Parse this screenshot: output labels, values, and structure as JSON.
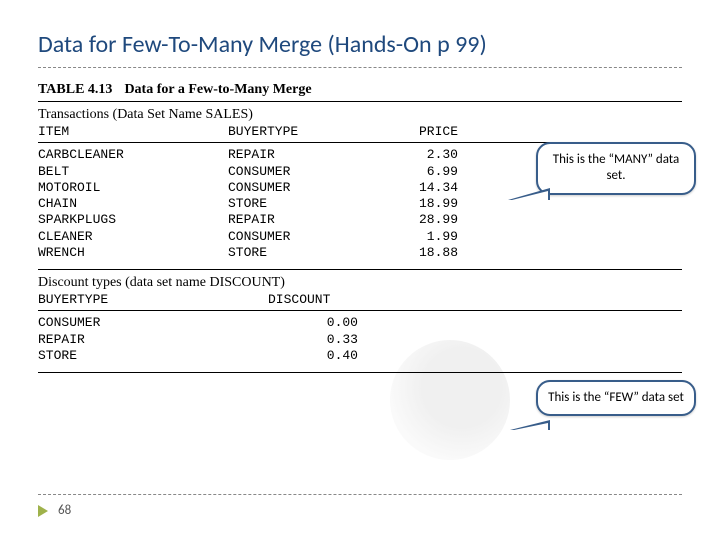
{
  "title": "Data for Few-To-Many Merge (Hands-On p 99)",
  "table_caption": {
    "num": "TABLE 4.13",
    "desc": "Data for a Few-to-Many Merge"
  },
  "sales": {
    "subhead": "Transactions (Data Set Name SALES)",
    "headers": {
      "c1": "ITEM",
      "c2": "BUYERTYPE",
      "c3": "PRICE"
    },
    "rows": [
      {
        "c1": "CARBCLEANER",
        "c2": "REPAIR",
        "c3": "2.30"
      },
      {
        "c1": "BELT",
        "c2": "CONSUMER",
        "c3": "6.99"
      },
      {
        "c1": "MOTOROIL",
        "c2": "CONSUMER",
        "c3": "14.34"
      },
      {
        "c1": "CHAIN",
        "c2": "STORE",
        "c3": "18.99"
      },
      {
        "c1": "SPARKPLUGS",
        "c2": "REPAIR",
        "c3": "28.99"
      },
      {
        "c1": "CLEANER",
        "c2": "CONSUMER",
        "c3": "1.99"
      },
      {
        "c1": "WRENCH",
        "c2": "STORE",
        "c3": "18.88"
      }
    ]
  },
  "discount": {
    "subhead": "Discount types (data set name DISCOUNT)",
    "headers": {
      "c1": "BUYERTYPE",
      "c2": "DISCOUNT"
    },
    "rows": [
      {
        "c1": "CONSUMER",
        "c2": "0.00"
      },
      {
        "c1": "REPAIR",
        "c2": "0.33"
      },
      {
        "c1": "STORE",
        "c2": "0.40"
      }
    ]
  },
  "callouts": {
    "many": "This is the “MANY” data set.",
    "few": "This is the “FEW” data set"
  },
  "page_number": "68",
  "chart_data": {
    "type": "table",
    "tables": [
      {
        "name": "SALES",
        "columns": [
          "ITEM",
          "BUYERTYPE",
          "PRICE"
        ],
        "rows": [
          [
            "CARBCLEANER",
            "REPAIR",
            2.3
          ],
          [
            "BELT",
            "CONSUMER",
            6.99
          ],
          [
            "MOTOROIL",
            "CONSUMER",
            14.34
          ],
          [
            "CHAIN",
            "STORE",
            18.99
          ],
          [
            "SPARKPLUGS",
            "REPAIR",
            28.99
          ],
          [
            "CLEANER",
            "CONSUMER",
            1.99
          ],
          [
            "WRENCH",
            "STORE",
            18.88
          ]
        ]
      },
      {
        "name": "DISCOUNT",
        "columns": [
          "BUYERTYPE",
          "DISCOUNT"
        ],
        "rows": [
          [
            "CONSUMER",
            0.0
          ],
          [
            "REPAIR",
            0.33
          ],
          [
            "STORE",
            0.4
          ]
        ]
      }
    ]
  }
}
